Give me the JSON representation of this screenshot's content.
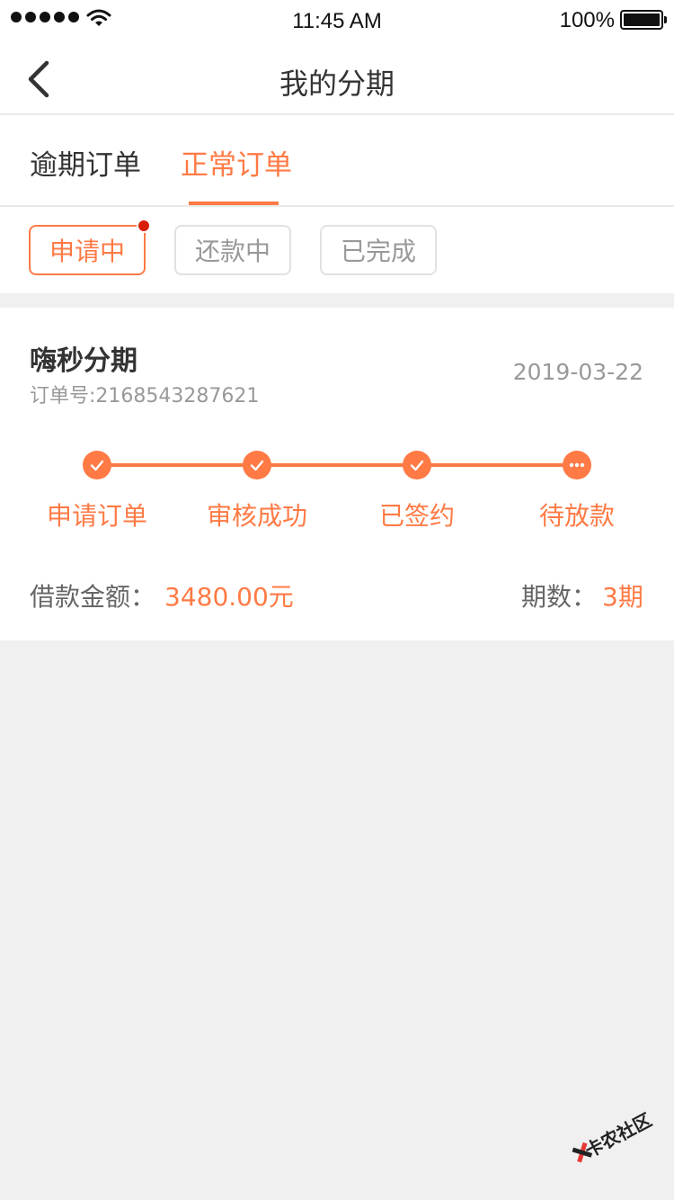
{
  "status_bar": {
    "time": "11:45 AM",
    "battery": "100%"
  },
  "nav": {
    "title": "我的分期",
    "back_icon": "chevron-left-icon"
  },
  "tabs": [
    {
      "label": "逾期订单",
      "active": false
    },
    {
      "label": "正常订单",
      "active": true
    }
  ],
  "filters": [
    {
      "label": "申请中",
      "active": true,
      "badge": true
    },
    {
      "label": "还款中",
      "active": false,
      "badge": false
    },
    {
      "label": "已完成",
      "active": false,
      "badge": false
    }
  ],
  "order": {
    "product": "嗨秒分期",
    "order_no": "订单号:2168543287621",
    "date": "2019-03-22",
    "steps": [
      {
        "label": "申请订单",
        "state": "done",
        "icon": "check-icon"
      },
      {
        "label": "审核成功",
        "state": "done",
        "icon": "check-icon"
      },
      {
        "label": "已签约",
        "state": "done",
        "icon": "check-icon"
      },
      {
        "label": "待放款",
        "state": "pending",
        "icon": "more-dots-icon"
      }
    ],
    "amount_label": "借款金额：",
    "amount_value": "3480.00元",
    "periods_label": "期数：",
    "periods_value": "3期"
  },
  "watermark": {
    "text": "卡农社区"
  },
  "colors": {
    "accent": "#ff7a45",
    "badge": "#d81e06",
    "background": "#f0f0f0"
  }
}
